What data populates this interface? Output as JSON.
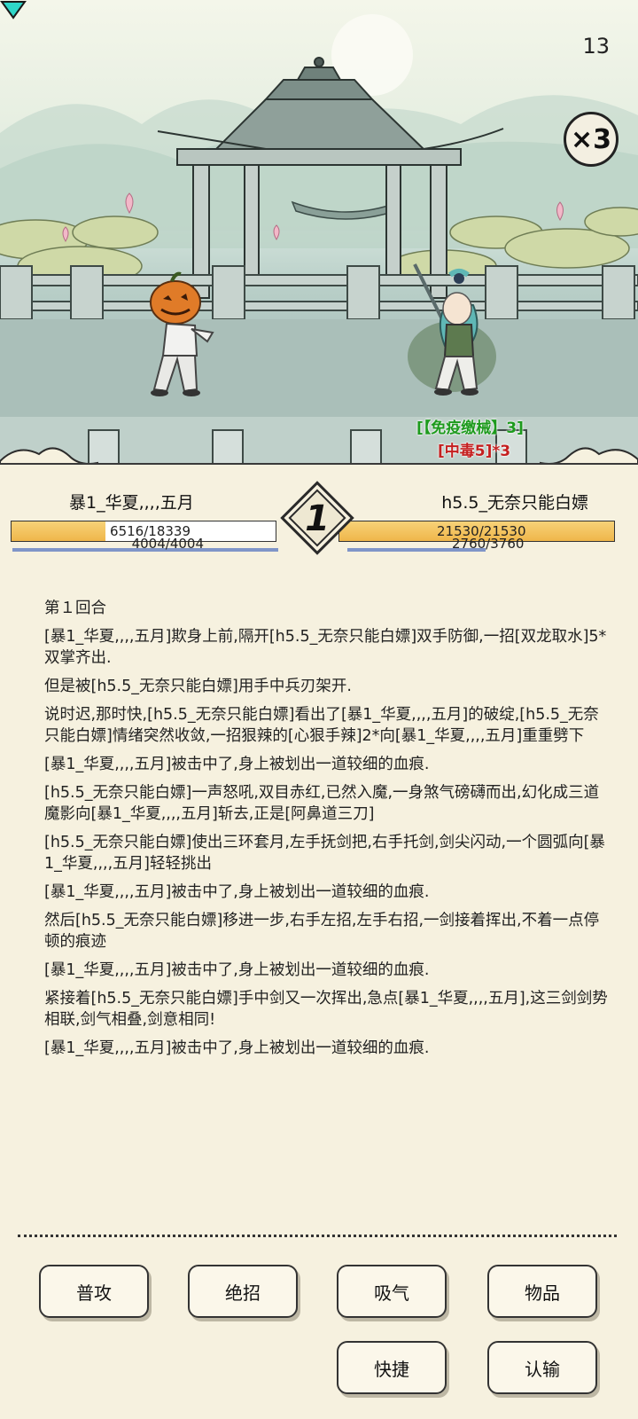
{
  "hud": {
    "timer": "13",
    "speed": "×3"
  },
  "status_effects": {
    "immunity": "[【免疫缴械】3]",
    "poison": "[中毒5]*3"
  },
  "players": {
    "left": {
      "name": "暴1_华夏,,,,五月",
      "hp": "6516/18339",
      "hp_ratio": 0.355,
      "mp": "4004/4004",
      "mp_ratio": 1.0
    },
    "right": {
      "name": "h5.5_无奈只能白嫖",
      "hp": "21530/21530",
      "hp_ratio": 1.0,
      "mp": "2760/3760",
      "mp_ratio": 0.734
    }
  },
  "round": {
    "number": "1"
  },
  "log": {
    "heading": "第１回合",
    "lines": [
      "[暴1_华夏,,,,五月]欺身上前,隔开[h5.5_无奈只能白嫖]双手防御,一招[双龙取水]5*双掌齐出.",
      "但是被[h5.5_无奈只能白嫖]用手中兵刃架开.",
      "说时迟,那时快,[h5.5_无奈只能白嫖]看出了[暴1_华夏,,,,五月]的破绽,[h5.5_无奈只能白嫖]情绪突然收敛,一招狠辣的[心狠手辣]2*向[暴1_华夏,,,,五月]重重劈下",
      "[暴1_华夏,,,,五月]被击中了,身上被划出一道较细的血痕.",
      "[h5.5_无奈只能白嫖]一声怒吼,双目赤红,已然入魔,一身煞气磅礴而出,幻化成三道魔影向[暴1_华夏,,,,五月]斩去,正是[阿鼻道三刀]",
      "[h5.5_无奈只能白嫖]使出三环套月,左手抚剑把,右手托剑,剑尖闪动,一个圆弧向[暴1_华夏,,,,五月]轻轻挑出",
      "[暴1_华夏,,,,五月]被击中了,身上被划出一道较细的血痕.",
      "然后[h5.5_无奈只能白嫖]移进一步,右手左招,左手右招,一剑接着挥出,不着一点停顿的痕迹",
      "[暴1_华夏,,,,五月]被击中了,身上被划出一道较细的血痕.",
      "紧接着[h5.5_无奈只能白嫖]手中剑又一次挥出,急点[暴1_华夏,,,,五月],这三剑剑势相联,剑气相叠,剑意相同!",
      "[暴1_华夏,,,,五月]被击中了,身上被划出一道较细的血痕."
    ]
  },
  "actions": {
    "normal_attack": "普攻",
    "ultimate": "绝招",
    "breathe": "吸气",
    "items": "物品",
    "shortcut": "快捷",
    "surrender": "认输"
  }
}
